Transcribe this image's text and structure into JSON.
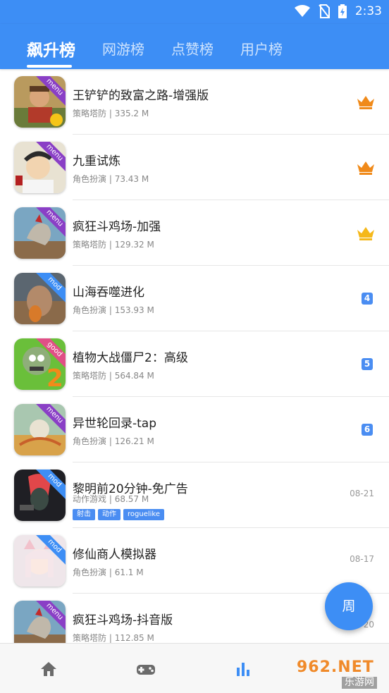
{
  "status_bar": {
    "time": "2:33"
  },
  "tabs": [
    {
      "label": "飙升榜",
      "active": true
    },
    {
      "label": "网游榜"
    },
    {
      "label": "点赞榜"
    },
    {
      "label": "用户榜"
    }
  ],
  "list": [
    {
      "title": "王铲铲的致富之路-增强版",
      "category": "策略塔防",
      "size": "335.2 M",
      "ribbon": "menu",
      "rank": 1,
      "rank_color": "#f08a1a"
    },
    {
      "title": "九重试炼",
      "category": "角色扮演",
      "size": "73.43 M",
      "ribbon": "menu",
      "rank": 2,
      "rank_color": "#f08a1a"
    },
    {
      "title": "疯狂斗鸡场-加强",
      "category": "策略塔防",
      "size": "129.32 M",
      "ribbon": "menu",
      "rank": 3,
      "rank_color": "#f5b81a"
    },
    {
      "title": "山海吞噬进化",
      "category": "角色扮演",
      "size": "153.93 M",
      "ribbon": "mod",
      "rank_label": "4"
    },
    {
      "title": "植物大战僵尸2：高级",
      "category": "策略塔防",
      "size": "564.84 M",
      "ribbon": "good",
      "rank_label": "5"
    },
    {
      "title": "异世轮回录-tap",
      "category": "角色扮演",
      "size": "126.21 M",
      "ribbon": "menu",
      "rank_label": "6"
    },
    {
      "title": "黎明前20分钟-免广告",
      "category": "动作游戏",
      "size": "68.57 M",
      "ribbon": "mod",
      "date": "08-21",
      "tags": [
        "射击",
        "动作",
        "roguelike"
      ]
    },
    {
      "title": "修仙商人模拟器",
      "category": "角色扮演",
      "size": "61.1 M",
      "ribbon": "mod",
      "date": "08-17"
    },
    {
      "title": "疯狂斗鸡场-抖音版",
      "category": "策略塔防",
      "size": "112.85 M",
      "ribbon": "menu",
      "date": "08-20"
    }
  ],
  "fab": {
    "label": "周"
  },
  "watermark": {
    "brand": "962.NET",
    "sub": "乐游网"
  },
  "colors": {
    "primary": "#3d8ef5",
    "ribbon_menu": "#8a3fc6",
    "ribbon_mod": "#3d8ef5",
    "ribbon_good": "#e04f86"
  },
  "icons": {
    "home": "home-icon",
    "games": "gamepad-icon",
    "rank": "bar-chart-icon"
  }
}
